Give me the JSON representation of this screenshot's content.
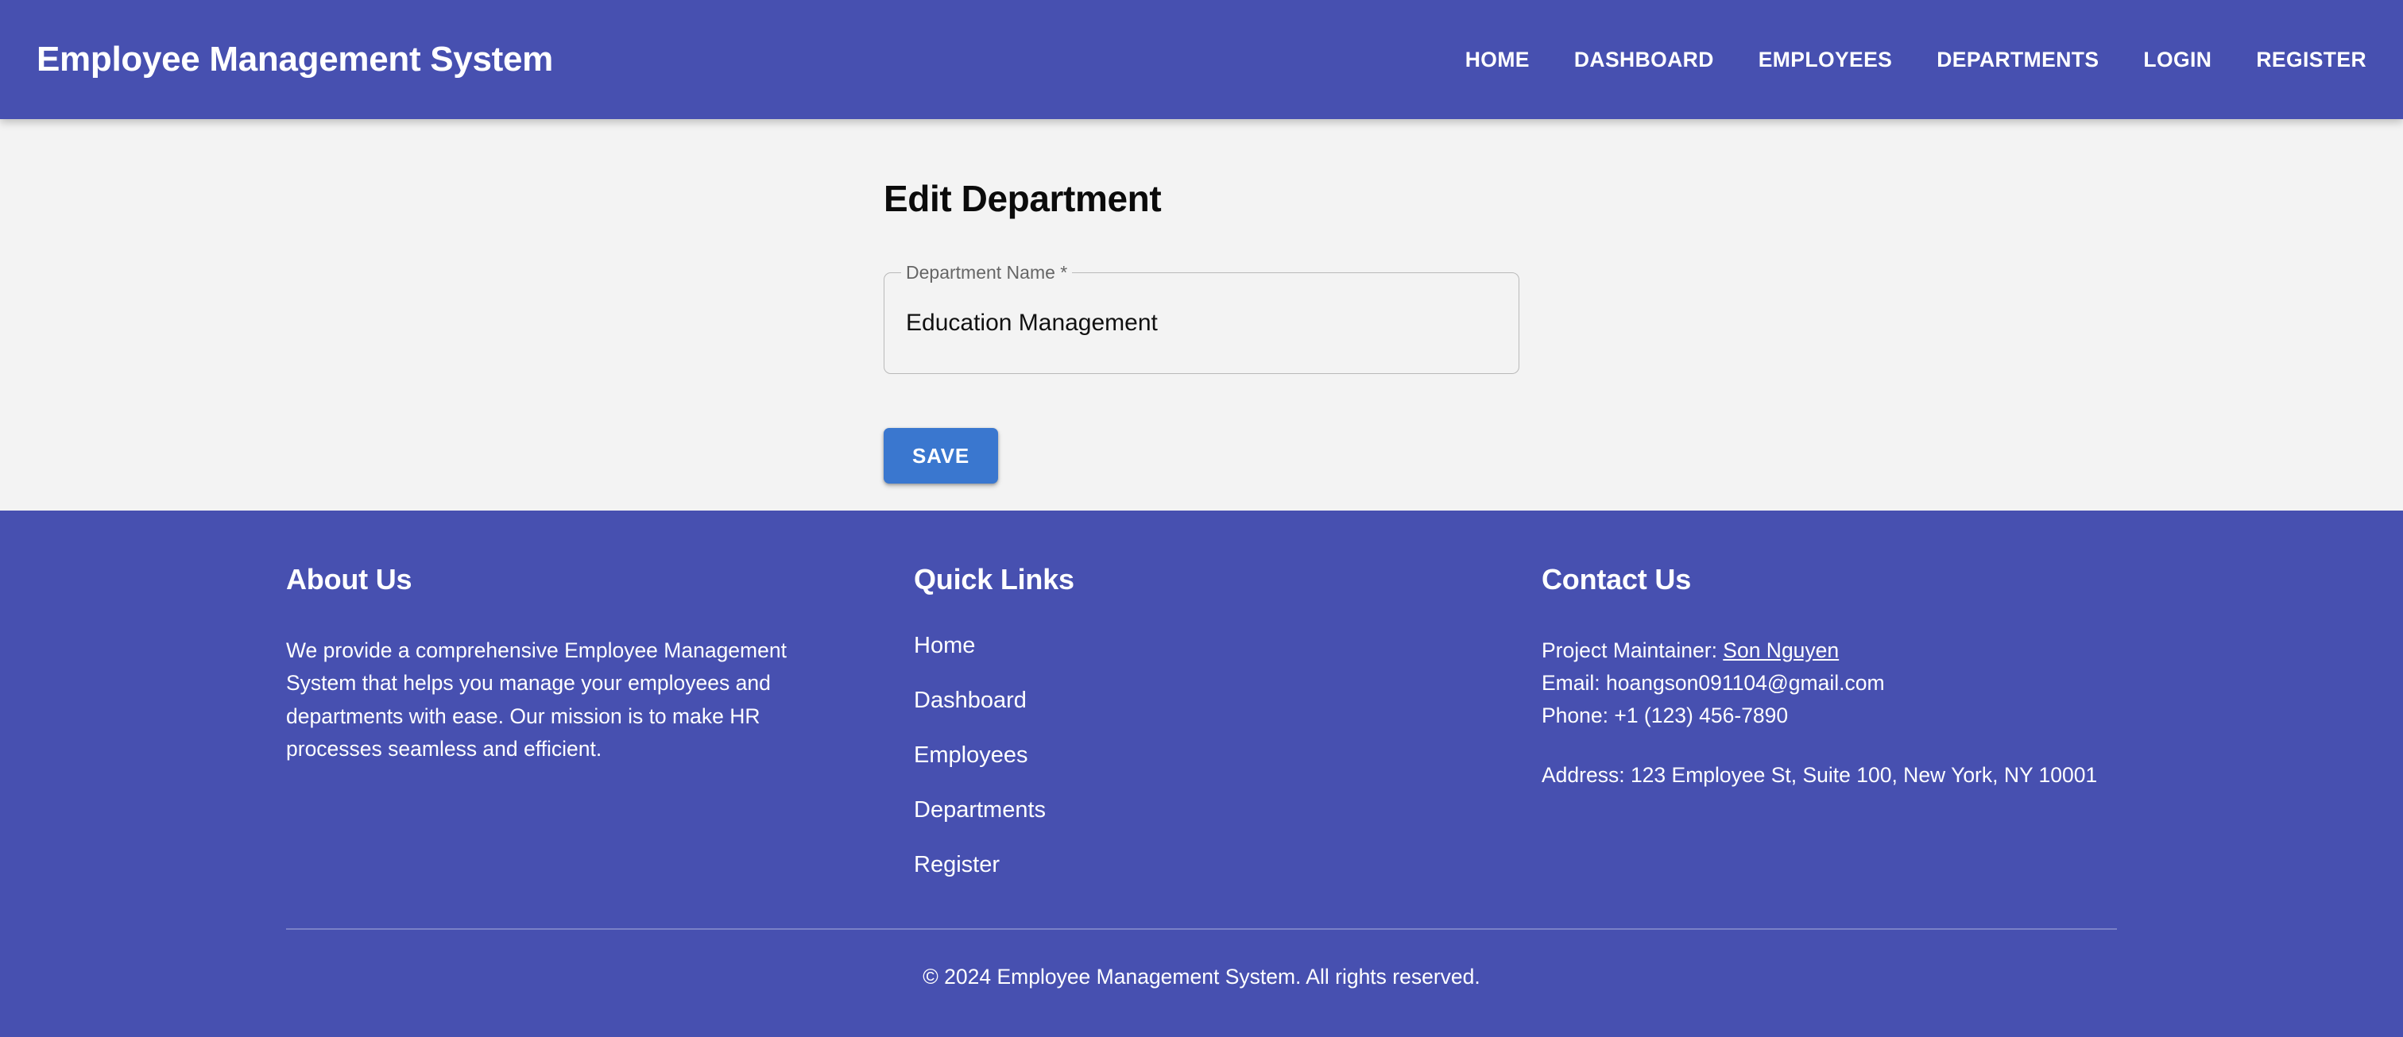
{
  "header": {
    "brand": "Employee Management System",
    "nav": [
      {
        "label": "HOME"
      },
      {
        "label": "DASHBOARD"
      },
      {
        "label": "EMPLOYEES"
      },
      {
        "label": "DEPARTMENTS"
      },
      {
        "label": "LOGIN"
      },
      {
        "label": "REGISTER"
      }
    ]
  },
  "main": {
    "title": "Edit Department",
    "field": {
      "label": "Department Name *",
      "value": "Education Management",
      "placeholder": ""
    },
    "save_label": "SAVE"
  },
  "footer": {
    "about": {
      "heading": "About Us",
      "text": "We provide a comprehensive Employee Management System that helps you manage your employees and departments with ease. Our mission is to make HR processes seamless and efficient."
    },
    "quick_links": {
      "heading": "Quick Links",
      "items": [
        {
          "label": "Home"
        },
        {
          "label": "Dashboard"
        },
        {
          "label": "Employees"
        },
        {
          "label": "Departments"
        },
        {
          "label": "Register"
        }
      ]
    },
    "contact": {
      "heading": "Contact Us",
      "maintainer_prefix": "Project Maintainer: ",
      "maintainer_name": "Son Nguyen",
      "email": "Email: hoangson091104@gmail.com",
      "phone": "Phone: +1 (123) 456-7890",
      "address": "Address: 123 Employee St, Suite 100, New York, NY 10001"
    },
    "copyright": "© 2024 Employee Management System. All rights reserved."
  },
  "colors": {
    "brand_blue": "#4750b0",
    "button_blue": "#3a77cf",
    "page_background": "#f3f3f3",
    "field_border": "#b9b9b9"
  }
}
